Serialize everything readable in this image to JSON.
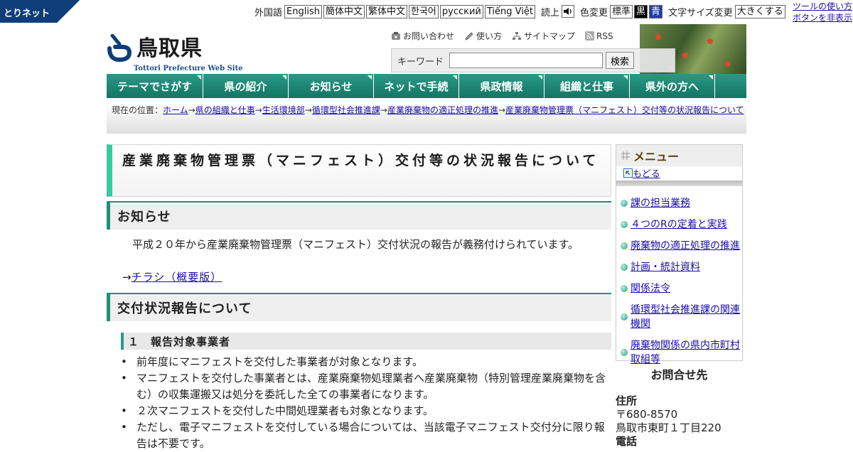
{
  "topbar": {
    "brand": "とりネット",
    "foreign_label": "外国語",
    "languages": [
      "English",
      "簡体中文",
      "繁体中文",
      "한국어",
      "русский",
      "Tiếng Việt"
    ],
    "read_label": "読上",
    "color_label": "色変更",
    "color_options": [
      "標準",
      "黒",
      "青"
    ],
    "font_label": "文字サイズ変更",
    "font_button": "大きくする",
    "tool_help": "ツールの使い方",
    "hide_buttons": "ボタンを非表示"
  },
  "header": {
    "logo_kanji": "鳥取県",
    "logo_english": "Tottori Prefecture Web Site",
    "links": [
      "お問い合わせ",
      "使い方",
      "サイトマップ",
      "RSS"
    ],
    "keyword_label": "キーワード",
    "search_value": "",
    "search_button": "検索"
  },
  "nav": {
    "tabs": [
      "テーマでさがす",
      "県の紹介",
      "お知らせ",
      "ネットで手続",
      "県政情報",
      "組織と仕事",
      "県外の方へ"
    ]
  },
  "breadcrumb": {
    "label": "現在の位置：",
    "items": [
      "ホーム",
      "県の組織と仕事",
      "生活環境部",
      "循環型社会推進課",
      "産業廃棄物の適正処理の推進",
      "産業廃棄物管理票（マニフェスト）交付等の状況報告について"
    ],
    "separator": "→"
  },
  "main": {
    "title": "産業廃棄物管理票（マニフェスト）交付等の状況報告について",
    "section1": {
      "heading": "お知らせ",
      "text": "平成２０年から産業廃棄物管理票（マニフェスト）交付状況の報告が義務付けられています。",
      "link_prefix": "→",
      "link": "チラシ（概要版）"
    },
    "section2": {
      "heading": "交付状況報告について",
      "sub": "１　報告対象事業者",
      "bullets": [
        "前年度にマニフェストを交付した事業者が対象となります。",
        "マニフェストを交付した事業者とは、産業廃棄物処理業者へ産業廃棄物（特別管理産業廃棄物を含む）の収集運搬又は処分を委託した全ての事業者になります。",
        "２次マニフェストを交付した中間処理業者も対象となります。",
        "ただし、電子マニフェストを交付している場合については、当該電子マニフェスト交付分に限り報告は不要です。"
      ]
    }
  },
  "sidemenu": {
    "heading": "メニュー",
    "back": "もどる",
    "items": [
      "課の担当業務",
      "４つのRの定着と実践",
      "廃棄物の適正処理の推進",
      "計画・統計資料",
      "関係法令",
      "循環型社会推進課の関連機関",
      "廃棄物関係の県内市町村取組等"
    ]
  },
  "contact": {
    "title": "お問合せ先",
    "address_label": "住所",
    "postal": "〒680-8570",
    "address": "鳥取市東町１丁目220",
    "phone_label": "電話"
  },
  "colors": {
    "nav_green": "#137563",
    "title_accent": "#35c9a0",
    "brand_blue": "#0f3d7a"
  }
}
